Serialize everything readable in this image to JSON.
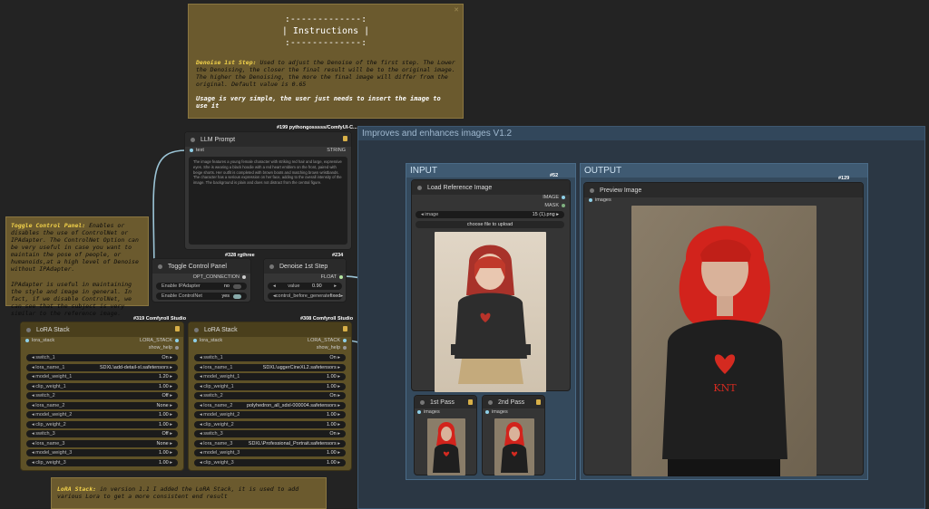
{
  "instructions": {
    "title_border_top": ":-------------:",
    "title": "| Instructions |",
    "title_border_bottom": ":-------------:",
    "denoise_label": "Denoise 1st Step:",
    "denoise_text": "Used to adjust the Denoise of the first step. The Lower the Denoising, the closer the final result will be to the original image. The higher the Denoising, the more the final image will differ from the original. Default value is 0.65",
    "usage_text": "Usage is very simple, the user just needs to insert the image to use it"
  },
  "toggle_note": {
    "label": "Toggle Control Panel:",
    "text": "Enables or disables the use of ControlNet or IPAdapter. The ControlNet Option can be very useful in case you want to maintain the pose of people, or humanoids,at a high level of Denoise without IPAdapter.",
    "text2": "IPAdapter is useful in maintaining the style and image in general. In fact, if we disable ControlNet, we can see that the subject is very similar to the reference image."
  },
  "lora_note": {
    "label": "LoRA Stack:",
    "text": "in version 1.1 I added the LoRA Stack, it is used to add various Lora to get a more consistent end result"
  },
  "llm": {
    "badge": "#199 pythongosssss/ComfyUI-C...",
    "title": "LLM Prompt",
    "input": "text",
    "output": "STRING",
    "body": "The image features a young female character with striking red hair and large, expressive eyes. She is wearing a black hoodie with a red heart emblem on the front, paired with beige shorts. Her outfit is completed with brown boots and matching brown wristbands. The character has a serious expression on her face, adding to the overall intensity of the image. The background is plain and does not distract from the central figure."
  },
  "toggle": {
    "badge": "#328 rgthree",
    "title": "Toggle Control Panel",
    "output": "OPT_CONNECTION",
    "rows": [
      {
        "label": "Enable IPAdapter",
        "value": "no"
      },
      {
        "label": "Enable ControlNet",
        "value": "yes"
      }
    ]
  },
  "denoise": {
    "badge": "#234",
    "title": "Denoise 1st Step",
    "output": "FLOAT",
    "rows": [
      {
        "label": "value",
        "value": "0.90"
      },
      {
        "label": "control_before_generate",
        "value": "fixed"
      }
    ]
  },
  "lora1": {
    "badge": "#319 Comfyroll Studio",
    "title": "LoRA Stack",
    "input": "lora_stack",
    "output": "LORA_STACK",
    "output2": "show_help",
    "rows": [
      {
        "label": "switch_1",
        "value": "On"
      },
      {
        "label": "lora_name_1",
        "value": "SDXL\\add-detail-xl.safetensors"
      },
      {
        "label": "model_weight_1",
        "value": "1.20"
      },
      {
        "label": "clip_weight_1",
        "value": "1.00"
      },
      {
        "label": "switch_2",
        "value": "Off"
      },
      {
        "label": "lora_name_2",
        "value": "None"
      },
      {
        "label": "model_weight_2",
        "value": "1.00"
      },
      {
        "label": "clip_weight_2",
        "value": "1.00"
      },
      {
        "label": "switch_3",
        "value": "Off"
      },
      {
        "label": "lora_name_3",
        "value": "None"
      },
      {
        "label": "model_weight_3",
        "value": "1.00"
      },
      {
        "label": "clip_weight_3",
        "value": "1.00"
      }
    ]
  },
  "lora2": {
    "badge": "#308 Comfyroll Studio",
    "title": "LoRA Stack",
    "input": "lora_stack",
    "output": "LORA_STACK",
    "output2": "show_help",
    "rows": [
      {
        "label": "switch_1",
        "value": "On"
      },
      {
        "label": "lora_name_1",
        "value": "SDXL\\uggerCineXL2.safetensors"
      },
      {
        "label": "model_weight_1",
        "value": "1.00"
      },
      {
        "label": "clip_weight_1",
        "value": "1.00"
      },
      {
        "label": "switch_2",
        "value": "On"
      },
      {
        "label": "lora_name_2",
        "value": "polyhedron_all_sdxl-000004.safetensors"
      },
      {
        "label": "model_weight_2",
        "value": "1.00"
      },
      {
        "label": "clip_weight_2",
        "value": "1.00"
      },
      {
        "label": "switch_3",
        "value": "On"
      },
      {
        "label": "lora_name_3",
        "value": "SDXL\\Professional_Portrait.safetensors"
      },
      {
        "label": "model_weight_3",
        "value": "1.00"
      },
      {
        "label": "clip_weight_3",
        "value": "1.00"
      }
    ]
  },
  "group_main": {
    "title": "Improves and enhances images V1.2"
  },
  "group_input": {
    "title": "INPUT"
  },
  "group_output": {
    "title": "OUTPUT"
  },
  "load_image": {
    "badge": "#52",
    "title": "Load Reference Image",
    "out1": "IMAGE",
    "out2": "MASK",
    "image_label": "image",
    "image_value": "15 (1).png",
    "upload_label": "choose file to upload"
  },
  "preview": {
    "badge": "#129",
    "title": "Preview Image",
    "input": "images",
    "shirt_text": "KNT"
  },
  "pass1": {
    "title": "1st Pass",
    "input": "images"
  },
  "pass2": {
    "title": "2nd Pass",
    "input": "images"
  },
  "colors": {
    "background": "#232323",
    "note": "#6b5a2e",
    "group": "#2e3f52",
    "wire": "#8fd0e8"
  }
}
